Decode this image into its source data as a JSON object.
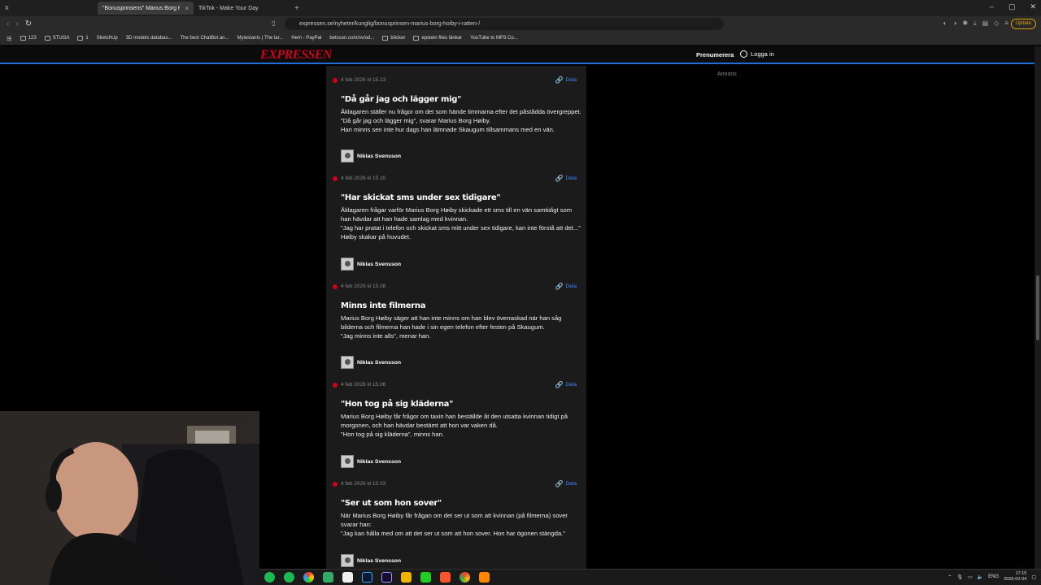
{
  "browser": {
    "tabs": [
      {
        "label": "X"
      },
      {
        "label": "\"Bonusprinsens\" Marius Borg Hø"
      },
      {
        "label": "TikTok - Make Your Day"
      }
    ],
    "url": "expressen.se/nyheter/kunglig/bonusprinsen-marius-borg-hoiby-i-ratten-/",
    "update_label": "Update",
    "bookmarks": [
      "123",
      "STUGA",
      "1",
      "SketchUp",
      "3D models databas...",
      "The best ChatBot an...",
      "Myiestants | The lar...",
      "Hem - PayPal",
      "betsson.com/sv/od...",
      "böcker",
      "epstein files länkar",
      "YouTube to MP3 Co..."
    ]
  },
  "site": {
    "logo": "EXPRESSEN",
    "subscribe_label": "Prenumerera",
    "login_label": "Logga in",
    "ad_label": "Annons",
    "accent_color": "#d0021b",
    "link_color": "#3b8bff"
  },
  "feed": [
    {
      "time": "4 feb 2026 kl 15.13",
      "share": "Dela",
      "headline": "\"Då går jag och lägger mig\"",
      "body": [
        "Åklagaren ställer nu frågor om det som hände timmarna efter det påstådda övergreppet.",
        "\"Då går jag och lägger mig\", svarar Marius Borg Høiby.",
        "Han minns sen inte hur dags han lämnade Skaugum tillsammans med en vän."
      ],
      "author": "Niklas Svensson"
    },
    {
      "time": "4 feb 2026 kl 15.10",
      "share": "Dela",
      "headline": "\"Har skickat sms under sex tidigare\"",
      "body": [
        "Åklagaren frågar varför Marius Borg Høiby skickade ett sms till en vän samtidigt som han hävdar att han hade samlag med kvinnan.",
        "\"Jag har pratat i telefon och skickat sms mitt under sex tidigare, kan inte förstå att det...\"",
        "Høiby skakar på huvudet."
      ],
      "author": "Niklas Svensson"
    },
    {
      "time": "4 feb 2026 kl 15.08",
      "share": "Dela",
      "headline": "Minns inte filmerna",
      "body": [
        "Marius Borg Høiby säger att han inte minns om han blev överraskad när han såg bilderna och filmerna han hade i sin egen telefon efter festen på Skaugum.",
        "\"Jag minns inte alls\", menar han."
      ],
      "author": "Niklas Svensson"
    },
    {
      "time": "4 feb 2026 kl 15.06",
      "share": "Dela",
      "headline": "\"Hon tog på sig kläderna\"",
      "body": [
        "Marius Borg Høiby får frågor om taxin han beställde åt den utsatta kvinnan tidigt på morgonen, och han hävdar bestämt att hon var vaken då.",
        "\"Hon tog på sig kläderna\", minns han."
      ],
      "author": "Niklas Svensson"
    },
    {
      "time": "4 feb 2026 kl 15.03",
      "share": "Dela",
      "headline": "\"Ser ut som hon sover\"",
      "body": [
        "När Marius Borg Høiby får frågan om det ser ut som att kvinnan (på filmerna) sover svarar han:",
        "\"Jag kan hålla med om att det ser ut som att hon sover. Hon har ögonen stängda.\""
      ],
      "author": "Niklas Svensson"
    }
  ],
  "taskbar": {
    "lang": "ENG",
    "time": "17:15",
    "date": "2026-02-04"
  }
}
